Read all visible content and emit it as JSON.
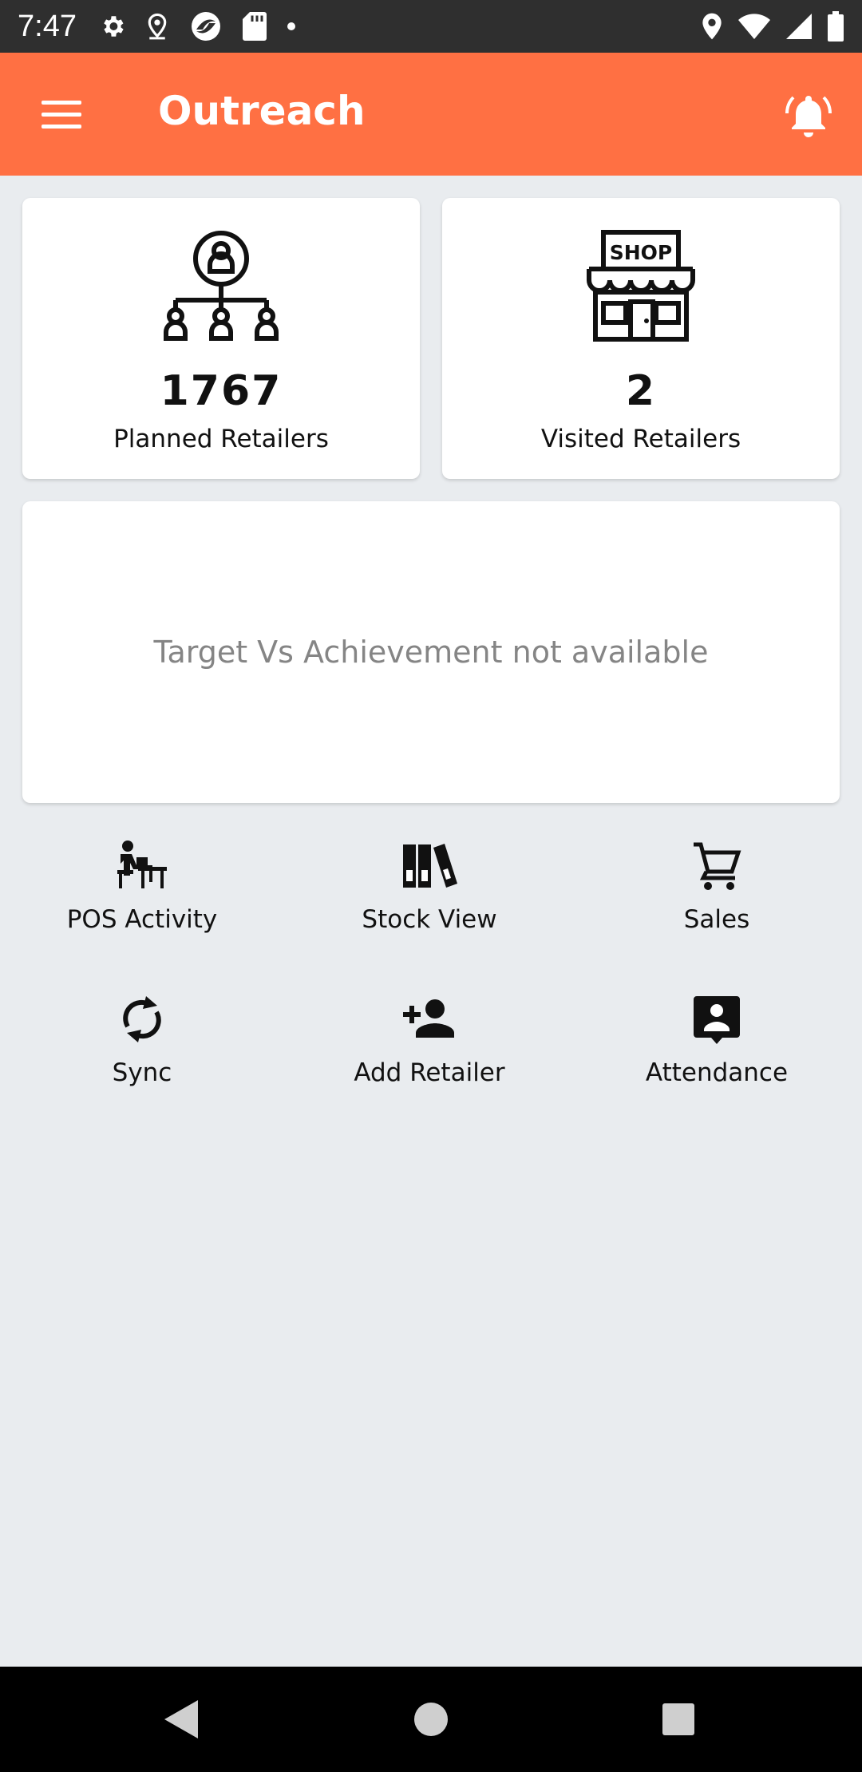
{
  "status_bar": {
    "time": "7:47"
  },
  "app_bar": {
    "title": "Outreach"
  },
  "stats": {
    "planned": {
      "value": "1767",
      "label": "Planned Retailers"
    },
    "visited": {
      "value": "2",
      "label": "Visited Retailers",
      "shop_sign": "SHOP"
    }
  },
  "target": {
    "message": "Target Vs Achievement not available"
  },
  "actions": [
    {
      "label": "POS Activity",
      "icon": "pos-activity-icon"
    },
    {
      "label": "Stock View",
      "icon": "stock-view-icon"
    },
    {
      "label": "Sales",
      "icon": "cart-icon"
    },
    {
      "label": "Sync",
      "icon": "sync-icon"
    },
    {
      "label": "Add Retailer",
      "icon": "add-person-icon"
    },
    {
      "label": "Attendance",
      "icon": "attendance-icon"
    }
  ],
  "colors": {
    "accent": "#ff7043",
    "background": "#e9ecef",
    "status_bar": "#2f2f2f"
  }
}
